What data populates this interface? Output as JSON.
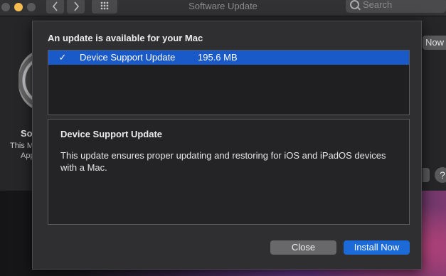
{
  "window": {
    "title": "Software Update",
    "nav_back_icon": "chevron-left",
    "nav_forward_icon": "chevron-right",
    "search_placeholder": "Search"
  },
  "background_pane": {
    "title_fragment": "So",
    "sub_line1_fragment": "This M",
    "sub_line2_fragment": "App",
    "upgrade_button_fragment": "Now",
    "help_label": "?"
  },
  "dialog": {
    "heading": "An update is available for your Mac",
    "updates": [
      {
        "checked": true,
        "check_mark": "✓",
        "name": "Device Support Update",
        "size": "195.6 MB"
      }
    ],
    "detail_title": "Device Support Update",
    "detail_description": "This update ensures proper updating and restoring for iOS and iPadOS devices with a Mac.",
    "close_label": "Close",
    "install_label": "Install Now"
  },
  "colors": {
    "accent": "#1b6ad8",
    "selection": "#1a5ac8",
    "minimize": "#f5bd4f"
  }
}
